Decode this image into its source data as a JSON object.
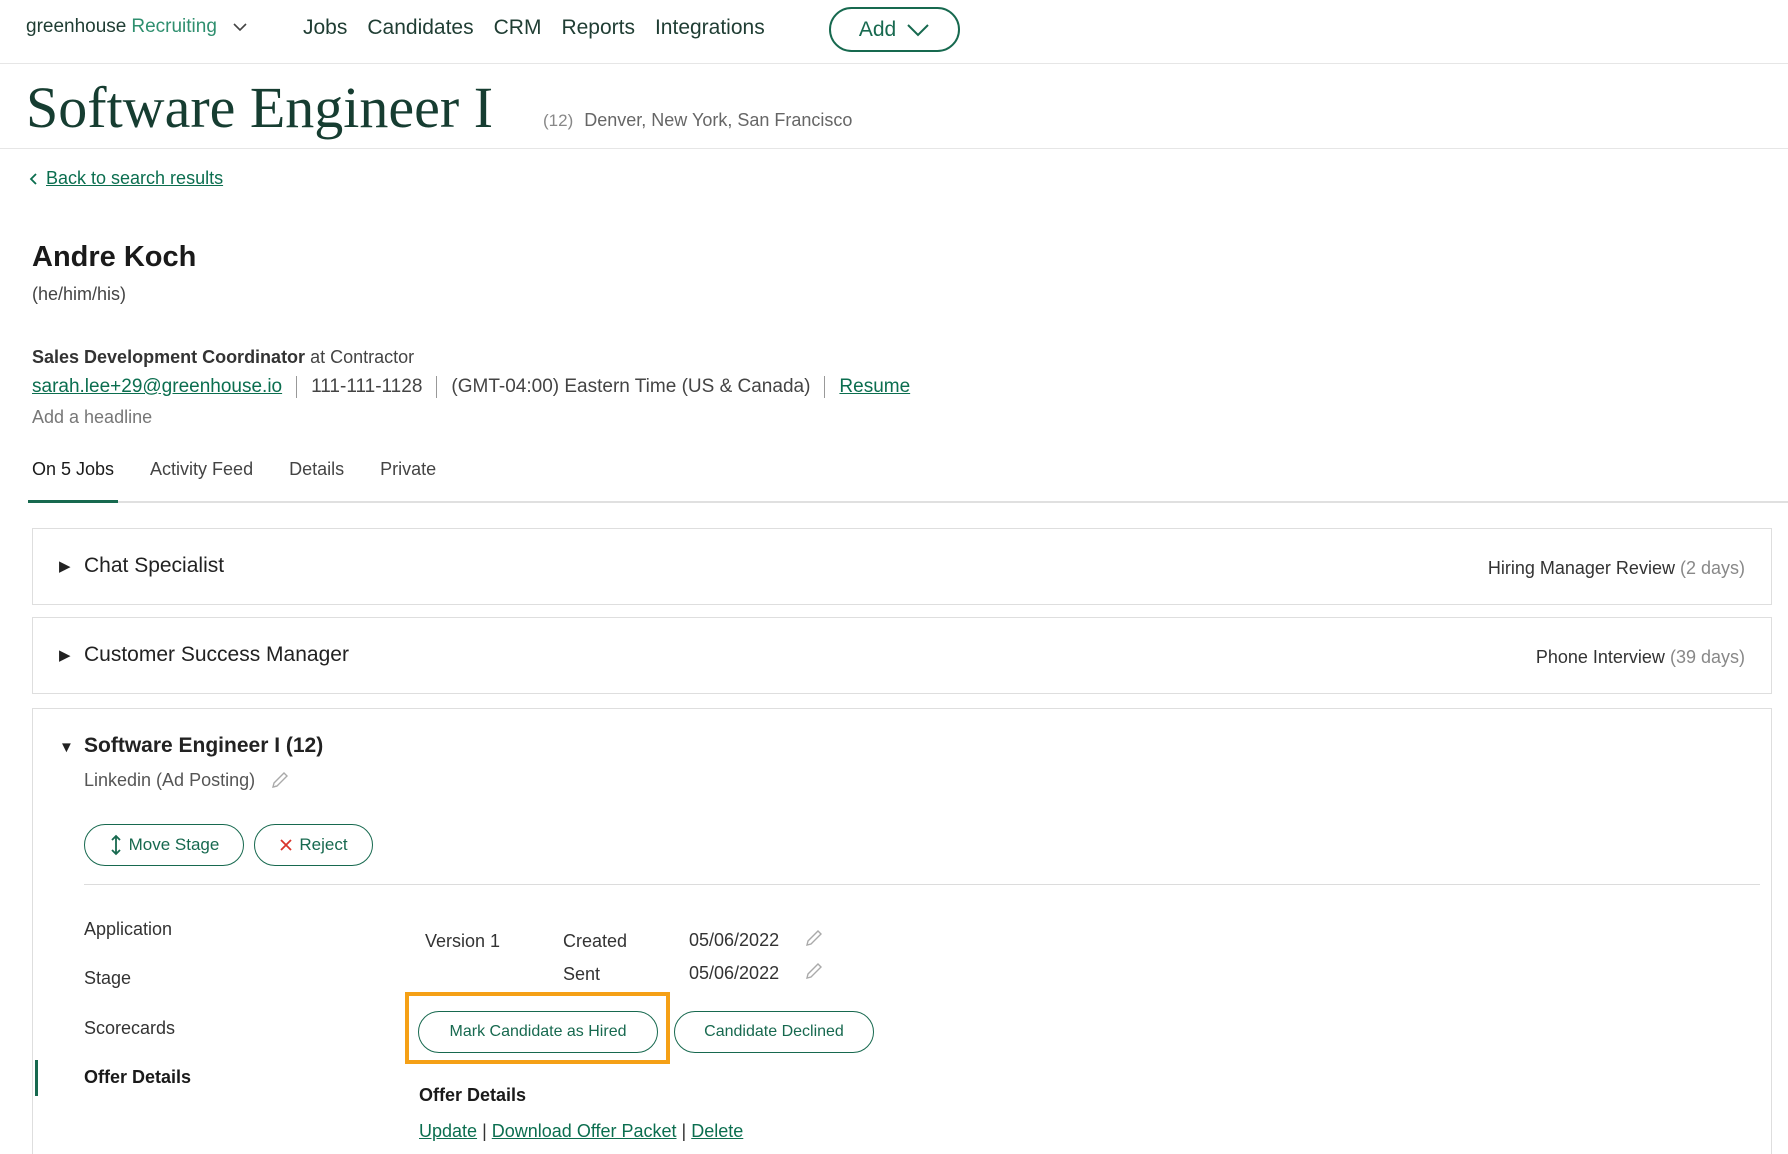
{
  "nav": {
    "logo_main": "greenhouse",
    "logo_product": "Recruiting",
    "links": [
      "Jobs",
      "Candidates",
      "CRM",
      "Reports",
      "Integrations"
    ],
    "add_label": "Add"
  },
  "job": {
    "title": "Software Engineer I",
    "count": "(12)",
    "locations": "Denver, New York, San Francisco"
  },
  "back_link": "Back to search results",
  "candidate": {
    "name": "Andre Koch",
    "pronouns": "(he/him/his)",
    "role": "Sales Development Coordinator",
    "at_company": "at Contractor",
    "email": "sarah.lee+29@greenhouse.io",
    "phone": "111-111-1128",
    "timezone": "(GMT-04:00) Eastern Time (US & Canada)",
    "resume": "Resume",
    "headline_placeholder": "Add a headline"
  },
  "tabs": [
    "On 5 Jobs",
    "Activity Feed",
    "Details",
    "Private"
  ],
  "jobs": [
    {
      "name": "Chat Specialist",
      "stage": "Hiring Manager Review",
      "days": "(2 days)"
    },
    {
      "name": "Customer Success Manager",
      "stage": "Phone Interview",
      "days": "(39 days)"
    }
  ],
  "expanded_job": {
    "name": "Software Engineer I (12)",
    "source": "Linkedin (Ad Posting)",
    "move_stage": "Move Stage",
    "reject": "Reject",
    "sections": [
      "Application",
      "Stage",
      "Scorecards",
      "Offer Details"
    ],
    "offer": {
      "version": "Version 1",
      "created_label": "Created",
      "created_date": "05/06/2022",
      "sent_label": "Sent",
      "sent_date": "05/06/2022",
      "mark_hired": "Mark Candidate as Hired",
      "declined": "Candidate Declined",
      "heading": "Offer Details",
      "update": "Update",
      "download": "Download Offer Packet",
      "delete": "Delete"
    }
  },
  "colors": {
    "brand_green": "#17694f",
    "highlight": "#f5a016"
  }
}
